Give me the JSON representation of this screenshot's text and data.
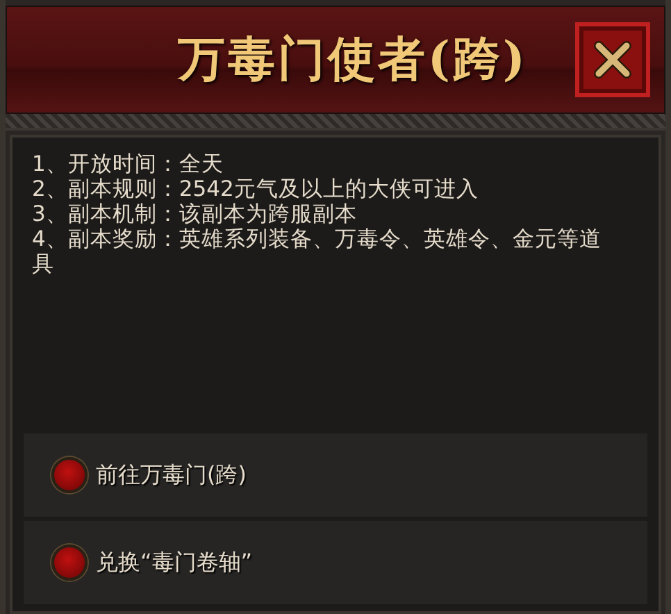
{
  "window": {
    "title": "万毒门使者(跨)"
  },
  "info_lines": [
    "1、开放时间：全天",
    "2、副本规则：2542元气及以上的大侠可进入",
    "3、副本机制：该副本为跨服副本",
    "4、副本奖励：英雄系列装备、万毒令、英雄令、金元等道具"
  ],
  "options": [
    {
      "label": "前往万毒门(跨)"
    },
    {
      "label": "兑换“毒门卷轴”"
    }
  ]
}
